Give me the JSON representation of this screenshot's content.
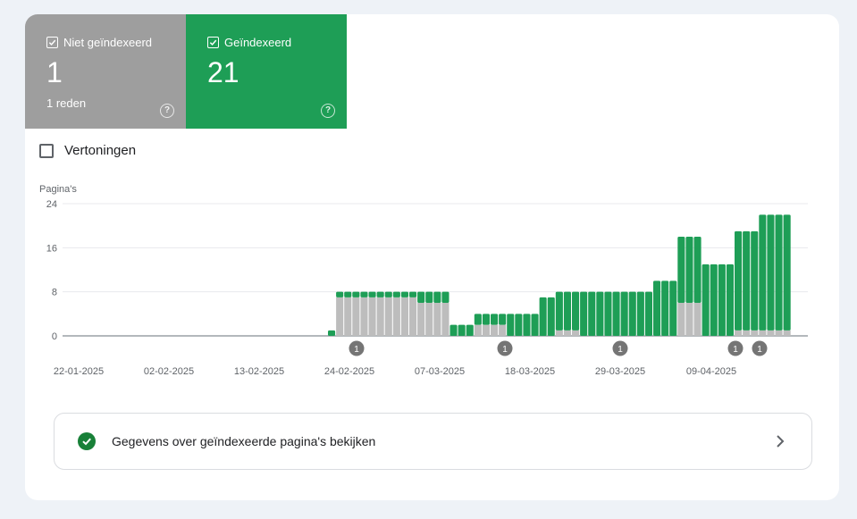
{
  "tiles": {
    "not_indexed": {
      "label": "Niet geïndexeerd",
      "value": "1",
      "sub": "1 reden",
      "color": "#9e9e9e",
      "checked": true
    },
    "indexed": {
      "label": "Geïndexeerd",
      "value": "21",
      "color": "#1e9e56",
      "checked": true
    }
  },
  "impressions": {
    "label": "Vertoningen",
    "checked": false
  },
  "link": {
    "label": "Gegevens over geïndexeerde pagina's bekijken"
  },
  "chart_data": {
    "type": "bar",
    "stacked": true,
    "ylabel": "Pagina's",
    "ylim": [
      0,
      24
    ],
    "yticks": [
      "0",
      "8",
      "16",
      "24"
    ],
    "xtick_labels": [
      "22-01-2025",
      "02-02-2025",
      "13-02-2025",
      "24-02-2025",
      "07-03-2025",
      "18-03-2025",
      "29-03-2025",
      "09-04-2025"
    ],
    "grid": true,
    "legend": "none",
    "colors": {
      "not_indexed": "#bdbdbd",
      "indexed": "#1e9e56"
    },
    "series": [
      {
        "name": "Niet geïndexeerd",
        "values": [
          0,
          0,
          0,
          0,
          0,
          0,
          0,
          0,
          0,
          0,
          0,
          0,
          0,
          0,
          0,
          0,
          0,
          0,
          0,
          0,
          0,
          0,
          0,
          0,
          0,
          0,
          0,
          0,
          0,
          0,
          0,
          0,
          0,
          0,
          0,
          0,
          0,
          0,
          0,
          0,
          0,
          7,
          7,
          7,
          7,
          7,
          7,
          7,
          7,
          7,
          7,
          6,
          6,
          6,
          6,
          0,
          0,
          0,
          2,
          2,
          2,
          2,
          0,
          0,
          0,
          0,
          0,
          0,
          1,
          1,
          1,
          0,
          0,
          0,
          0,
          0,
          0,
          0,
          0,
          0,
          0,
          0,
          0,
          6,
          6,
          6,
          0,
          0,
          0,
          0,
          1,
          1,
          1,
          1,
          1,
          1,
          1
        ]
      },
      {
        "name": "Geïndexeerd",
        "values": [
          0,
          0,
          0,
          0,
          0,
          0,
          0,
          0,
          0,
          0,
          0,
          0,
          0,
          0,
          0,
          0,
          0,
          0,
          0,
          0,
          0,
          0,
          0,
          0,
          0,
          0,
          0,
          0,
          0,
          0,
          0,
          0,
          0,
          0,
          0,
          0,
          0,
          0,
          0,
          0,
          1,
          1,
          1,
          1,
          1,
          1,
          1,
          1,
          1,
          1,
          1,
          2,
          2,
          2,
          2,
          2,
          2,
          2,
          2,
          2,
          2,
          2,
          4,
          4,
          4,
          4,
          7,
          7,
          7,
          7,
          7,
          8,
          8,
          8,
          8,
          8,
          8,
          8,
          8,
          8,
          10,
          10,
          10,
          12,
          12,
          12,
          13,
          13,
          13,
          13,
          18,
          18,
          18,
          21,
          21,
          21,
          21
        ]
      }
    ],
    "annotations": [
      {
        "label": "1",
        "date": "24-02-2025"
      },
      {
        "label": "1",
        "date": "18-03-2025"
      },
      {
        "label": "1",
        "date": "29-03-2025"
      },
      {
        "label": "1",
        "date": "09-04-2025"
      },
      {
        "label": "1",
        "date": "09-04-2025"
      }
    ]
  }
}
